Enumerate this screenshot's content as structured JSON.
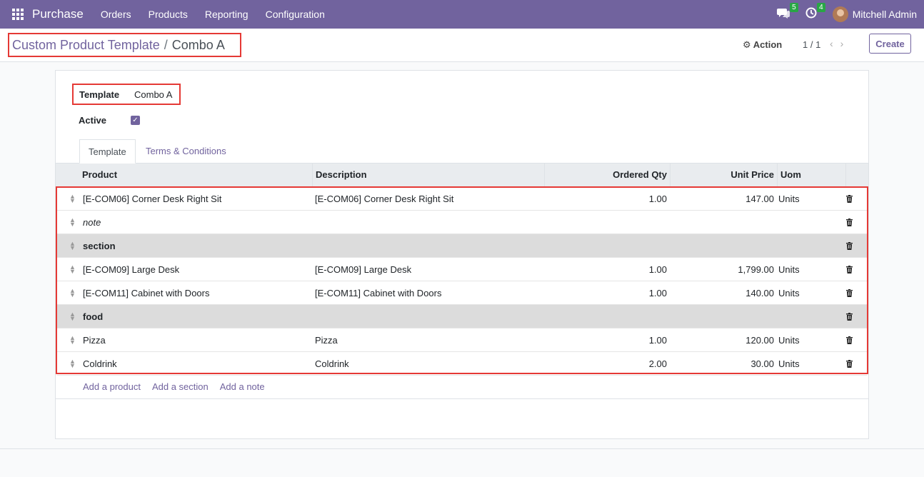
{
  "nav": {
    "app_name": "Purchase",
    "menu": [
      "Orders",
      "Products",
      "Reporting",
      "Configuration"
    ],
    "messages_count": "5",
    "activities_count": "4",
    "user_name": "Mitchell Admin"
  },
  "control": {
    "breadcrumb_parent": "Custom Product Template",
    "breadcrumb_separator": "/",
    "breadcrumb_current": "Combo A",
    "action_label": "Action",
    "pager": "1 / 1",
    "create_label": "Create"
  },
  "form": {
    "template_label": "Template",
    "template_value": "Combo A",
    "active_label": "Active",
    "active_checked": true
  },
  "tabs": [
    "Template",
    "Terms & Conditions"
  ],
  "table": {
    "headers": [
      "Product",
      "Description",
      "Ordered Qty",
      "Unit Price",
      "Uom"
    ],
    "rows": [
      {
        "type": "line",
        "product": "[E-COM06] Corner Desk Right Sit",
        "description": "[E-COM06] Corner Desk Right Sit",
        "qty": "1.00",
        "price": "147.00",
        "uom": "Units"
      },
      {
        "type": "note",
        "product": "note",
        "description": "",
        "qty": "",
        "price": "",
        "uom": ""
      },
      {
        "type": "section",
        "product": "section",
        "description": "",
        "qty": "",
        "price": "",
        "uom": ""
      },
      {
        "type": "line",
        "product": "[E-COM09] Large Desk",
        "description": "[E-COM09] Large Desk",
        "qty": "1.00",
        "price": "1,799.00",
        "uom": "Units"
      },
      {
        "type": "line",
        "product": "[E-COM11] Cabinet with Doors",
        "description": "[E-COM11] Cabinet with Doors",
        "qty": "1.00",
        "price": "140.00",
        "uom": "Units"
      },
      {
        "type": "section",
        "product": "food",
        "description": "",
        "qty": "",
        "price": "",
        "uom": ""
      },
      {
        "type": "line",
        "product": "Pizza",
        "description": "Pizza",
        "qty": "1.00",
        "price": "120.00",
        "uom": "Units"
      },
      {
        "type": "line",
        "product": "Coldrink",
        "description": "Coldrink",
        "qty": "2.00",
        "price": "30.00",
        "uom": "Units"
      }
    ],
    "add_links": [
      "Add a product",
      "Add a section",
      "Add a note"
    ]
  },
  "colors": {
    "brand": "#71639e",
    "highlight": "#e53935"
  }
}
